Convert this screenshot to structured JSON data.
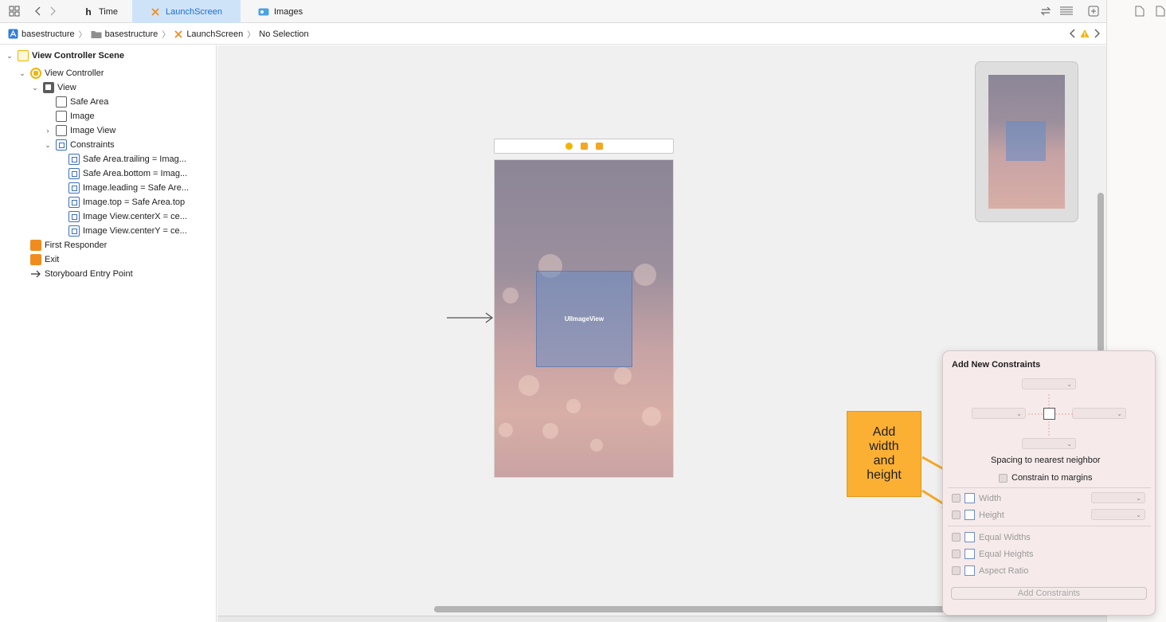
{
  "tabs": [
    {
      "label": "Time",
      "icon": "header-file-icon",
      "active": false
    },
    {
      "label": "LaunchScreen",
      "icon": "storyboard-icon",
      "active": true
    },
    {
      "label": "Images",
      "icon": "asset-catalog-icon",
      "active": false
    }
  ],
  "breadcrumbs": [
    "basestructure",
    "basestructure",
    "LaunchScreen",
    "No Selection"
  ],
  "outline": {
    "scene": "View Controller Scene",
    "view_controller": "View Controller",
    "view": "View",
    "safe_area": "Safe Area",
    "image": "Image",
    "image_view": "Image View",
    "constraints": "Constraints",
    "constraint_items": [
      "Safe Area.trailing = Imag...",
      "Safe Area.bottom = Imag...",
      "Image.leading = Safe Are...",
      "Image.top = Safe Area.top",
      "Image View.centerX = ce...",
      "Image View.centerY = ce..."
    ],
    "first_responder": "First Responder",
    "exit": "Exit",
    "entry_point": "Storyboard Entry Point"
  },
  "canvas": {
    "image_view_label": "UIImageView"
  },
  "callout": {
    "text_lines": [
      "Add",
      "width",
      "and",
      "height"
    ]
  },
  "popover": {
    "title": "Add New Constraints",
    "spacing_label": "Spacing to nearest neighbor",
    "constrain_margins": "Constrain to margins",
    "width": "Width",
    "height": "Height",
    "equal_widths": "Equal Widths",
    "equal_heights": "Equal Heights",
    "aspect_ratio": "Aspect Ratio",
    "add_button": "Add Constraints"
  },
  "colors": {
    "accent": "#1a6fd8",
    "callout": "#fbb034",
    "popover_bg": "#f6eaea"
  }
}
